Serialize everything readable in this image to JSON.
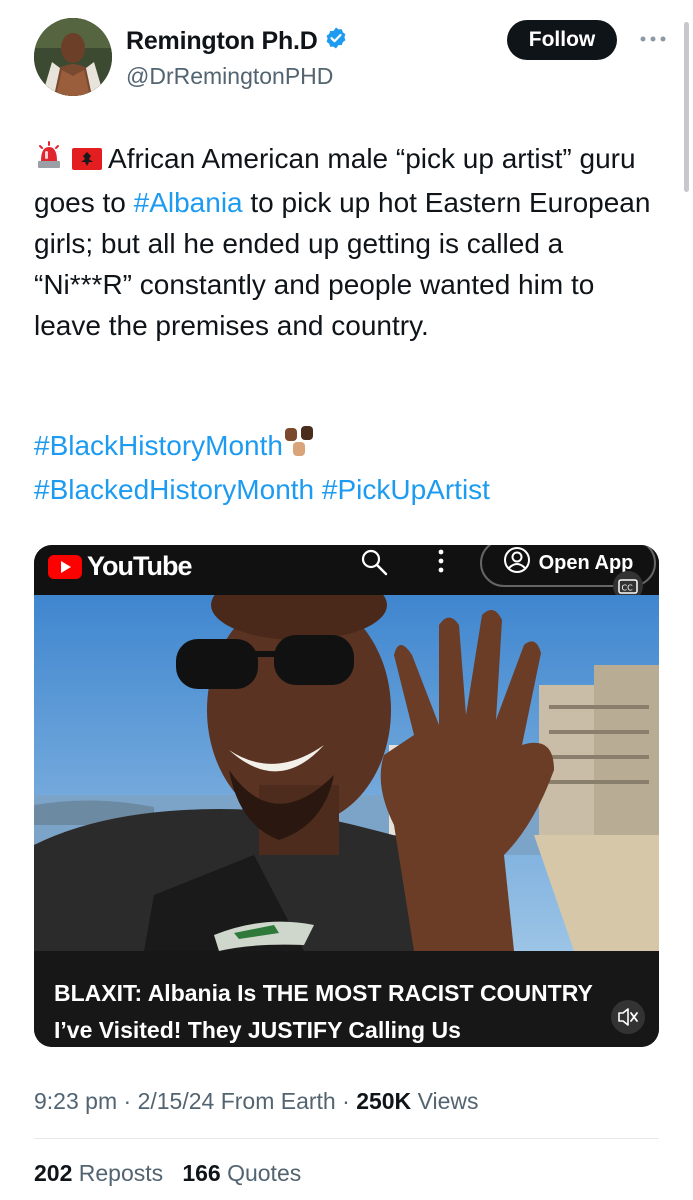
{
  "user": {
    "display_name": "Remington Ph.D",
    "handle": "@DrRemingtonPHD",
    "verified": true
  },
  "header": {
    "follow_label": "Follow",
    "more_icon": "more-horizontal-icon"
  },
  "tweet": {
    "line_prefix_emojis": [
      "police-light-emoji",
      "albania-flag-emoji"
    ],
    "text_before_link": "African American male “pick up artist” guru goes to ",
    "link_albania": "#Albania",
    "text_after_link": " to pick up hot Eastern European girls; but all he ended up getting is called a “Ni***R” constantly and people wanted him to leave the premises and country.",
    "hashtag_1": "#BlackHistoryMonth",
    "hashtag_1_emoji": "raised-fists-emoji",
    "hashtag_2": "#BlackedHistoryMonth",
    "hashtag_3": "#PickUpArtist"
  },
  "media": {
    "brand": "YouTube",
    "open_app_label": "Open App",
    "caption_line1": "BLAXIT: Albania Is THE MOST RACIST COUNTRY",
    "caption_line2": "I’ve Visited! They JUSTIFY Calling Us"
  },
  "meta": {
    "time": "9:23 pm",
    "date": "2/15/24",
    "location": "From Earth",
    "views_count": "250K",
    "views_label": "Views"
  },
  "stats": {
    "reposts_count": "202",
    "reposts_label": "Reposts",
    "quotes_count": "166",
    "quotes_label": "Quotes"
  },
  "colors": {
    "link": "#1d9bf0",
    "verified": "#1d9bf0",
    "muted": "#536471",
    "follow_bg": "#0f1419"
  }
}
